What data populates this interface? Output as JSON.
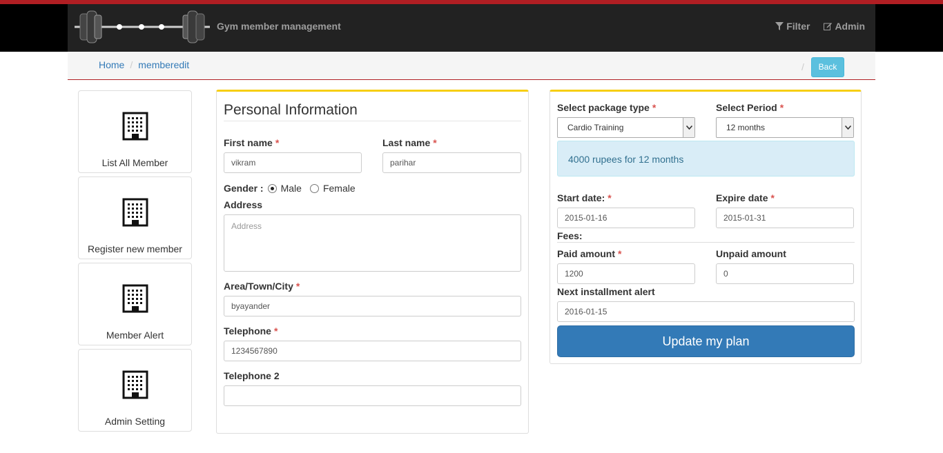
{
  "header": {
    "brand": "Gym member management",
    "filter_label": "Filter",
    "admin_label": "Admin"
  },
  "breadcrumb": {
    "home": "Home",
    "current": "memberedit",
    "back_label": "Back"
  },
  "sidebar": {
    "items": [
      {
        "label": "List All Member",
        "icon": "building-icon"
      },
      {
        "label": "Register new member",
        "icon": "building-icon"
      },
      {
        "label": "Member Alert",
        "icon": "building-icon"
      },
      {
        "label": "Admin Setting",
        "icon": "building-icon"
      }
    ]
  },
  "personal": {
    "title": "Personal Information",
    "first_name_label": "First name",
    "first_name_value": "vikram",
    "last_name_label": "Last name",
    "last_name_value": "parihar",
    "gender_label": "Gender :",
    "gender_options": [
      "Male",
      "Female"
    ],
    "gender_selected": "Male",
    "address_label": "Address",
    "address_placeholder": "Address",
    "city_label": "Area/Town/City",
    "city_value": "byayander",
    "telephone_label": "Telephone",
    "telephone_value": "1234567890",
    "telephone2_label": "Telephone 2",
    "telephone2_value": "",
    "required_mark": "*"
  },
  "plan": {
    "package_label": "Select package type",
    "package_value": "Cardio Training",
    "period_label": "Select Period",
    "period_value": "12 months",
    "info_text": "4000 rupees for 12 months",
    "start_label": "Start date:",
    "start_value": "2015-01-16",
    "expire_label": "Expire date",
    "expire_value": "2015-01-31",
    "fees_label": "Fees:",
    "paid_label": "Paid amount",
    "paid_value": "1200",
    "unpaid_label": "Unpaid amount",
    "unpaid_value": "0",
    "alert_label": "Next installment alert",
    "alert_value": "2016-01-15",
    "submit_label": "Update my plan"
  },
  "colors": {
    "accent_red": "#b01e23",
    "navbar": "#222222",
    "panel_top": "#f7ce14",
    "primary": "#337ab7",
    "info": "#5bc0de"
  }
}
